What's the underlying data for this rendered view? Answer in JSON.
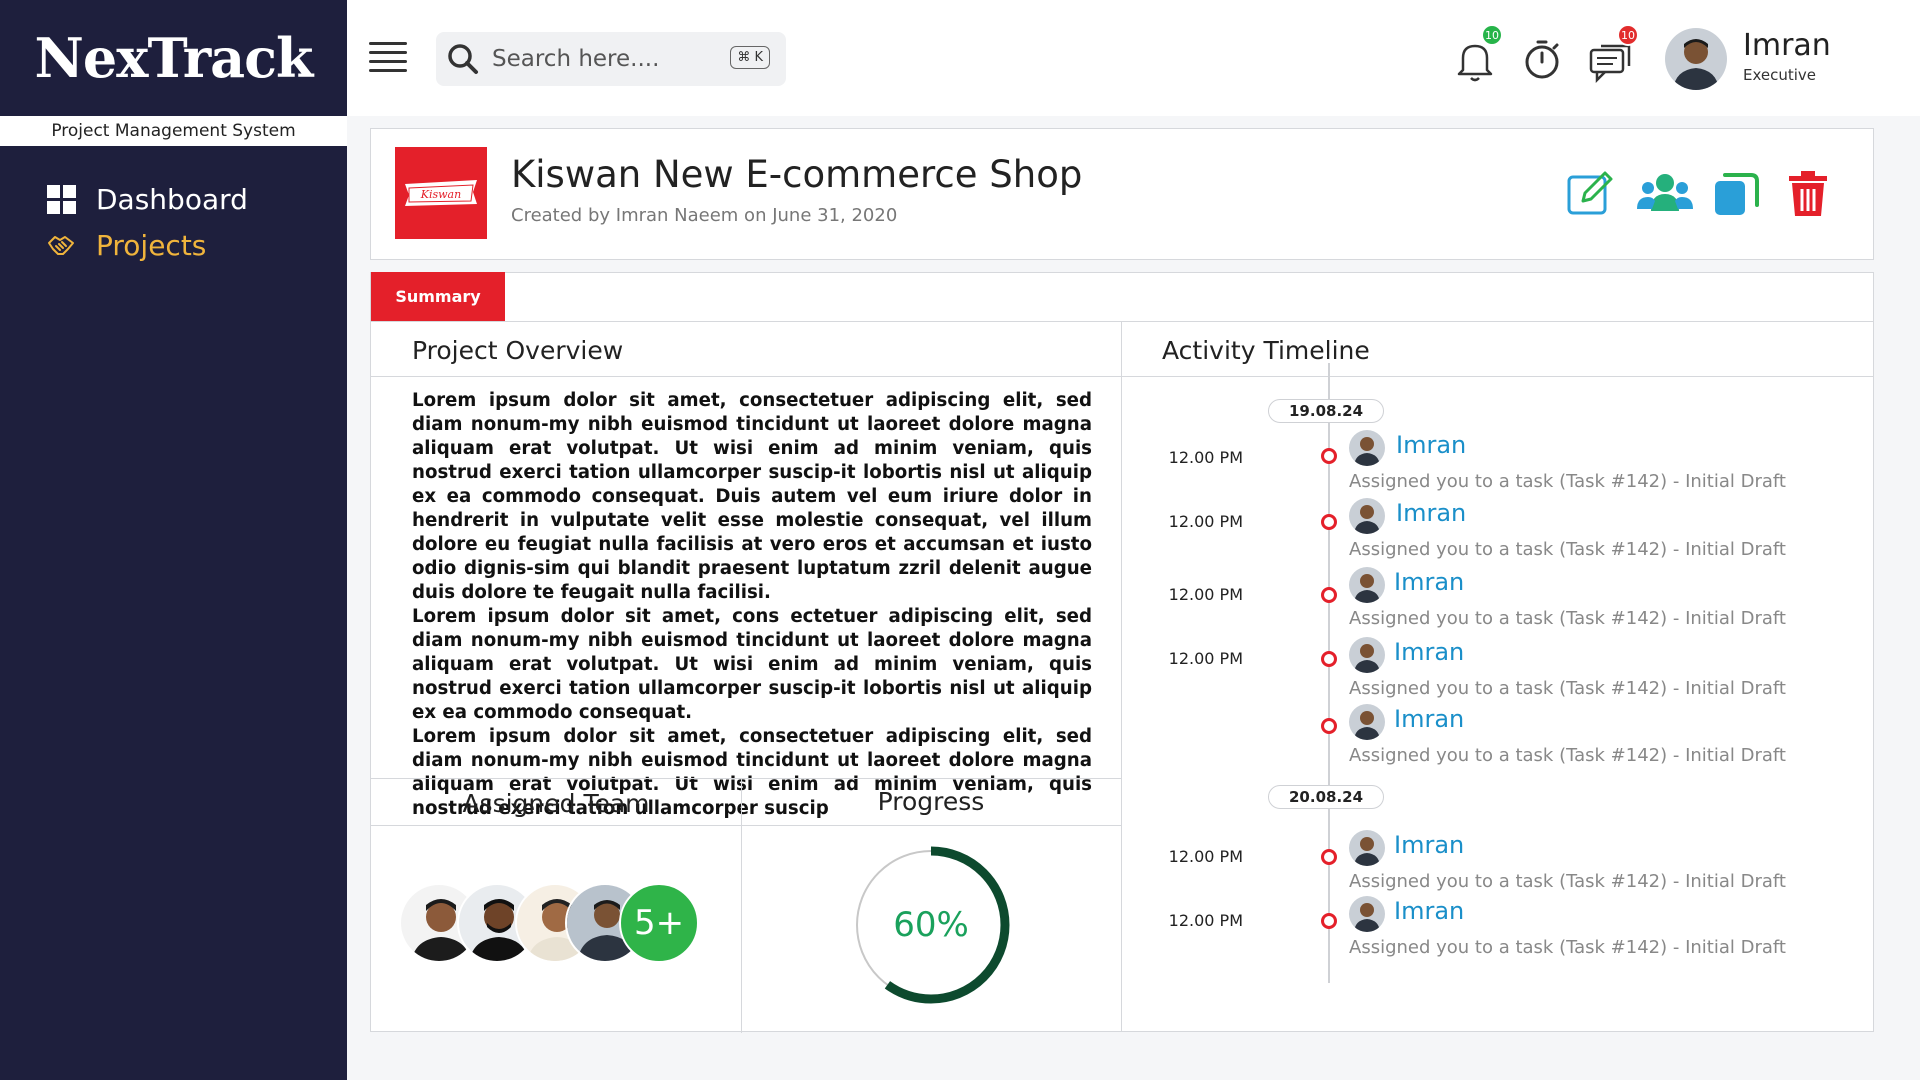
{
  "brand": {
    "name": "NexTrack",
    "subtitle": "Project Management System"
  },
  "sidebar": {
    "items": [
      {
        "label": "Dashboard",
        "icon": "grid-icon",
        "active": false
      },
      {
        "label": "Projects",
        "icon": "handshake-icon",
        "active": true
      }
    ]
  },
  "topbar": {
    "search": {
      "placeholder": "Search here....",
      "shortcut": "⌘ K"
    },
    "notifications": {
      "count": "10",
      "color": "#27b44a"
    },
    "messages": {
      "count": "10",
      "color": "#e22d2d"
    },
    "user": {
      "name": "Imran",
      "role": "Executive"
    }
  },
  "project": {
    "title": "Kiswan New E-commerce Shop",
    "created": "Created by Imran Naeem on June 31, 2020",
    "logo_text": "Kiswan"
  },
  "tabs": {
    "summary": "Summary"
  },
  "overview": {
    "title": "Project Overview",
    "paragraphs": [
      "Lorem ipsum dolor sit amet, consectetuer adipiscing elit, sed diam nonum-my nibh euismod tincidunt ut laoreet dolore magna aliquam erat volutpat. Ut wisi enim ad minim veniam, quis nostrud exerci tation ullamcorper suscip-it lobortis nisl ut aliquip ex ea commodo consequat. Duis autem vel eum iriure dolor in hendrerit in vulputate velit esse molestie consequat, vel illum dolore eu feugiat nulla facilisis at vero eros et accumsan et iusto odio dignis-sim qui blandit praesent luptatum zzril delenit augue duis dolore te feugait nulla facilisi.",
      "Lorem ipsum dolor sit amet, cons ectetuer adipiscing elit, sed diam nonum-my nibh euismod tincidunt ut laoreet dolore magna aliquam erat volutpat. Ut wisi enim ad minim veniam, quis nostrud exerci tation ullamcorper suscip-it lobortis nisl ut aliquip ex ea commodo consequat.",
      "Lorem ipsum dolor sit amet, consectetuer adipiscing elit, sed diam nonum-my nibh euismod tincidunt ut laoreet dolore magna aliquam erat volutpat. Ut wisi enim ad minim veniam, quis nostrud exerci tation ullamcorper suscip"
    ]
  },
  "team": {
    "title": "Assigned Team",
    "more": "5+"
  },
  "progress": {
    "title": "Progress",
    "value": 60,
    "label": "60%",
    "color": "#0d4a2e"
  },
  "timeline": {
    "title": "Activity Timeline",
    "dates": [
      "19.08.24",
      "20.08.24"
    ],
    "entries": [
      {
        "time": "12.00 PM",
        "name": "Imran",
        "desc": "Assigned you to a task (Task #142) - Initial Draft"
      },
      {
        "time": "12.00 PM",
        "name": "Imran",
        "desc": "Assigned you to a task (Task #142) - Initial Draft"
      },
      {
        "time": "12.00 PM",
        "name": "Imran",
        "desc": "Assigned you to a task (Task #142) - Initial Draft"
      },
      {
        "time": "12.00 PM",
        "name": "Imran",
        "desc": "Assigned you to a task (Task #142) - Initial Draft"
      },
      {
        "time": "",
        "name": "Imran",
        "desc": "Assigned you to a task (Task #142) - Initial Draft"
      },
      {
        "time": "12.00 PM",
        "name": "Imran",
        "desc": "Assigned you to a task (Task #142) - Initial Draft"
      },
      {
        "time": "12.00 PM",
        "name": "Imran",
        "desc": "Assigned you to a task (Task #142) - Initial Draft"
      }
    ]
  },
  "colors": {
    "sidebar": "#1e1f3d",
    "accent": "#e4202a",
    "active_nav": "#f0b43c",
    "link": "#1a8fc9"
  }
}
